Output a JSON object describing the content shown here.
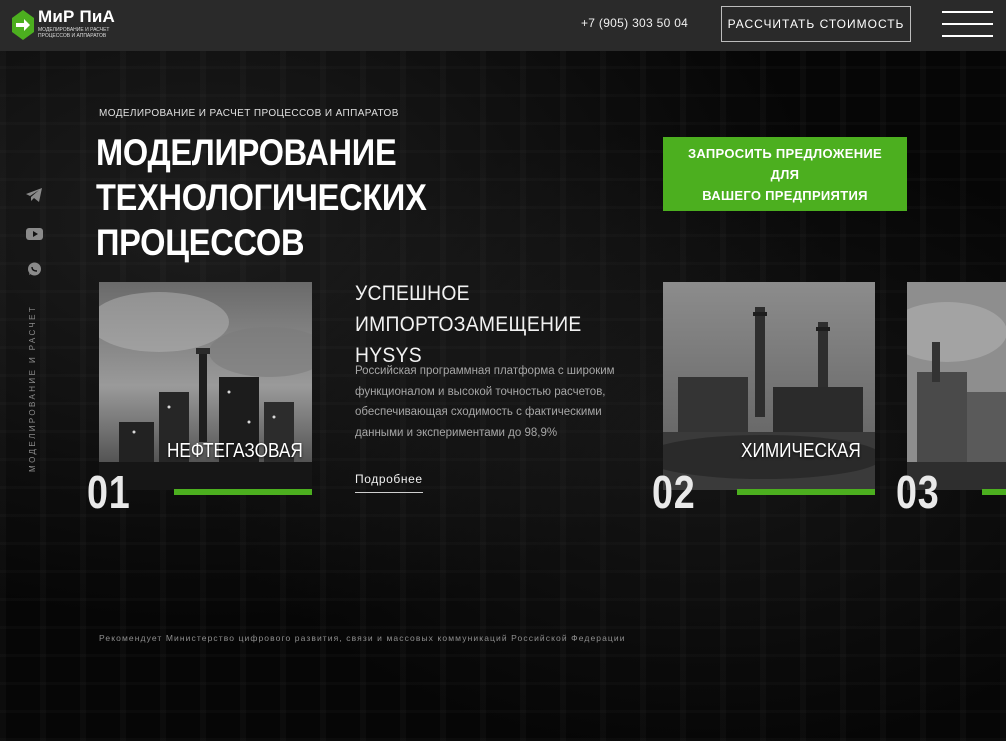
{
  "colors": {
    "accent": "#4caf1f",
    "header_bg": "#2a2a2a",
    "page_bg": "#050505"
  },
  "header": {
    "logo_title": "МиР ПиА",
    "logo_subtitle": "МОДЕЛИРОВАНИЕ И РАСЧЕТ ПРОЦЕССОВ И АППАРАТОВ",
    "phone": "+7 (905) 303 50 04",
    "calc_button": "РАССЧИТАТЬ СТОИМОСТЬ",
    "menu_icon": "hamburger-menu-icon"
  },
  "side": {
    "socials": [
      {
        "icon": "telegram-icon"
      },
      {
        "icon": "youtube-icon"
      },
      {
        "icon": "whatsapp-icon"
      }
    ],
    "caption": "МОДЕЛИРОВАНИЕ И РАСЧЕТ"
  },
  "hero": {
    "eyebrow": "МОДЕЛИРОВАНИЕ И РАСЧЕТ ПРОЦЕССОВ И АППАРАТОВ",
    "title_line1": "МОДЕЛИРОВАНИЕ",
    "title_line2": "ТЕХНОЛОГИЧЕСКИХ ПРОЦЕССОВ",
    "cta_line1": "ЗАПРОСИТЬ ПРЕДЛОЖЕНИЕ ДЛЯ",
    "cta_line2": "ВАШЕГО ПРЕДПРИЯТИЯ"
  },
  "cards": [
    {
      "num": "01",
      "label": "НЕФТЕГАЗОВАЯ"
    },
    {
      "num": "02",
      "label": "ХИМИЧЕСКАЯ"
    },
    {
      "num": "03",
      "label": ""
    }
  ],
  "feature": {
    "title_line1": "УСПЕШНОЕ",
    "title_line2": "ИМПОРТОЗАМЕЩЕНИЕ HYSYS",
    "description": "Российская программная платформа с широким функционалом и высокой точностью расчетов, обеспечивающая сходимость с фактическими данными и экспериментами до 98,9%",
    "link": "Подробнее"
  },
  "footnote": "Рекомендует Министерство цифрового развития, связи и массовых коммуникаций Российской Федерации"
}
